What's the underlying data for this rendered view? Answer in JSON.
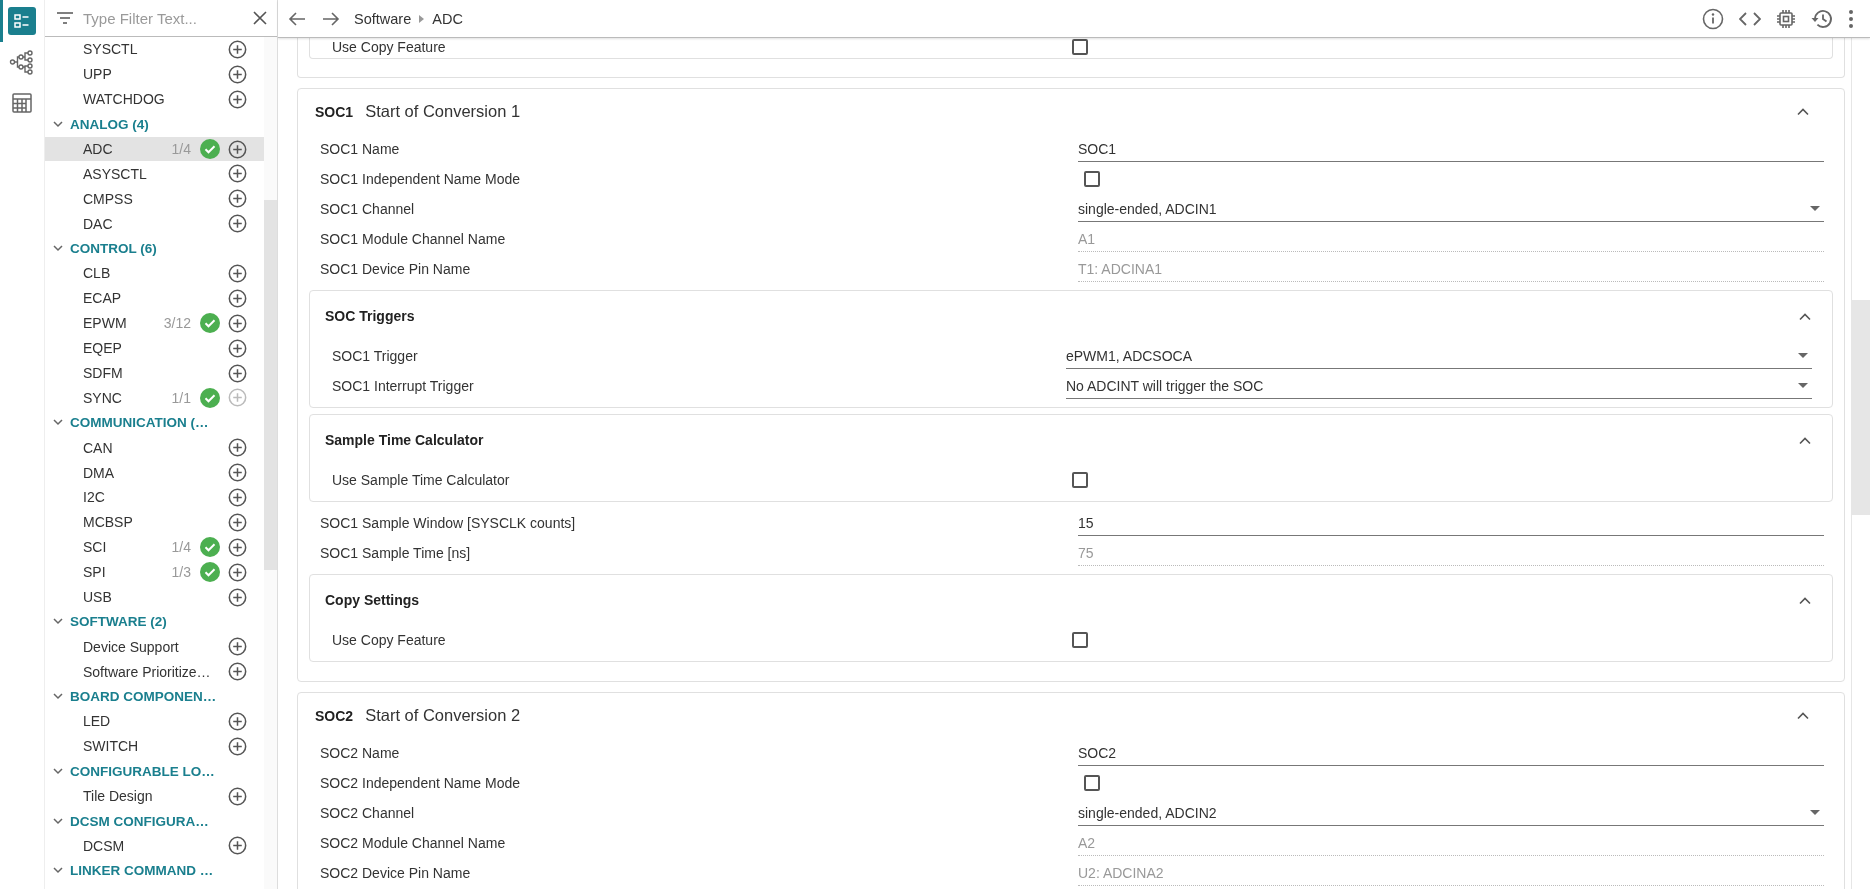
{
  "rail": [
    {
      "kind": "list",
      "selected": true
    },
    {
      "kind": "tree",
      "selected": false
    },
    {
      "kind": "calculator",
      "selected": false
    }
  ],
  "sidebar": {
    "filter": {
      "placeholder": "Type Filter Text..."
    },
    "items": [
      {
        "label": "SYSCTL",
        "configured": false,
        "add_disabled": false,
        "selected": false
      },
      {
        "label": "UPP",
        "configured": false,
        "add_disabled": false,
        "selected": false
      },
      {
        "label": "WATCHDOG",
        "configured": false,
        "add_disabled": false,
        "selected": false
      }
    ],
    "groups": [
      {
        "label": "ANALOG (4)",
        "expanded": true,
        "children": [
          {
            "label": "ADC",
            "count": "1/4",
            "configured": true,
            "add_disabled": false,
            "selected": true
          },
          {
            "label": "ASYSCTL",
            "configured": false,
            "add_disabled": false,
            "selected": false
          },
          {
            "label": "CMPSS",
            "configured": false,
            "add_disabled": false,
            "selected": false
          },
          {
            "label": "DAC",
            "configured": false,
            "add_disabled": false,
            "selected": false
          }
        ]
      },
      {
        "label": "CONTROL (6)",
        "expanded": true,
        "children": [
          {
            "label": "CLB",
            "configured": false,
            "add_disabled": false,
            "selected": false
          },
          {
            "label": "ECAP",
            "configured": false,
            "add_disabled": false,
            "selected": false
          },
          {
            "label": "EPWM",
            "count": "3/12",
            "configured": true,
            "add_disabled": false,
            "selected": false
          },
          {
            "label": "EQEP",
            "configured": false,
            "add_disabled": false,
            "selected": false
          },
          {
            "label": "SDFM",
            "configured": false,
            "add_disabled": false,
            "selected": false
          },
          {
            "label": "SYNC",
            "count": "1/1",
            "configured": true,
            "add_disabled": true,
            "selected": false
          }
        ]
      },
      {
        "label": "COMMUNICATION (…",
        "expanded": true,
        "children": [
          {
            "label": "CAN",
            "configured": false,
            "add_disabled": false,
            "selected": false
          },
          {
            "label": "DMA",
            "configured": false,
            "add_disabled": false,
            "selected": false
          },
          {
            "label": "I2C",
            "configured": false,
            "add_disabled": false,
            "selected": false
          },
          {
            "label": "MCBSP",
            "configured": false,
            "add_disabled": false,
            "selected": false
          },
          {
            "label": "SCI",
            "count": "1/4",
            "configured": true,
            "add_disabled": false,
            "selected": false
          },
          {
            "label": "SPI",
            "count": "1/3",
            "configured": true,
            "add_disabled": false,
            "selected": false
          },
          {
            "label": "USB",
            "configured": false,
            "add_disabled": false,
            "selected": false
          }
        ]
      },
      {
        "label": "SOFTWARE (2)",
        "expanded": true,
        "children": [
          {
            "label": "Device Support",
            "configured": false,
            "add_disabled": false,
            "selected": false
          },
          {
            "label": "Software Prioritize…",
            "configured": false,
            "add_disabled": false,
            "selected": false
          }
        ]
      },
      {
        "label": "BOARD COMPONEN…",
        "expanded": true,
        "children": [
          {
            "label": "LED",
            "configured": false,
            "add_disabled": false,
            "selected": false
          },
          {
            "label": "SWITCH",
            "configured": false,
            "add_disabled": false,
            "selected": false
          }
        ]
      },
      {
        "label": "CONFIGURABLE LO…",
        "expanded": true,
        "children": [
          {
            "label": "Tile Design",
            "configured": false,
            "add_disabled": false,
            "selected": false
          }
        ]
      },
      {
        "label": "DCSM CONFIGURA…",
        "expanded": true,
        "children": [
          {
            "label": "DCSM",
            "configured": false,
            "add_disabled": false,
            "selected": false
          }
        ]
      },
      {
        "label": "LINKER COMMAND …",
        "expanded": true
      }
    ]
  },
  "toolbar": {
    "breadcrumb": [
      "Software",
      "ADC"
    ]
  },
  "content": [
    {
      "kind": "partial",
      "items": [
        {
          "kind": "group",
          "rows": [
            {
              "kind": "checkbox",
              "label": "Use Copy Feature",
              "checked": false
            }
          ]
        }
      ]
    },
    {
      "kind": "card",
      "tag": "SOC1",
      "title": "Start of Conversion 1",
      "expanded": true,
      "items": [
        {
          "kind": "text",
          "label": "SOC1 Name",
          "value": "SOC1"
        },
        {
          "kind": "checkbox",
          "label": "SOC1 Independent Name Mode",
          "checked": false
        },
        {
          "kind": "select",
          "label": "SOC1 Channel",
          "value": "single-ended, ADCIN1"
        },
        {
          "kind": "readonly",
          "label": "SOC1 Module Channel Name",
          "value": "A1"
        },
        {
          "kind": "readonly",
          "label": "SOC1 Device Pin Name",
          "value": "T1: ADCINA1"
        },
        {
          "kind": "group",
          "title": "SOC Triggers",
          "expanded": true,
          "rows": [
            {
              "kind": "select",
              "label": "SOC1 Trigger",
              "value": "ePWM1, ADCSOCA"
            },
            {
              "kind": "select",
              "label": "SOC1 Interrupt Trigger",
              "value": "No ADCINT will trigger the SOC"
            }
          ]
        },
        {
          "kind": "group",
          "title": "Sample Time Calculator",
          "expanded": true,
          "rows": [
            {
              "kind": "checkbox",
              "label": "Use Sample Time Calculator",
              "checked": false
            }
          ]
        },
        {
          "kind": "text",
          "label": "SOC1 Sample Window [SYSCLK counts]",
          "value": "15"
        },
        {
          "kind": "readonly",
          "label": "SOC1 Sample Time [ns]",
          "value": "75"
        },
        {
          "kind": "group",
          "title": "Copy Settings",
          "expanded": true,
          "rows": [
            {
              "kind": "checkbox",
              "label": "Use Copy Feature",
              "checked": false
            }
          ]
        }
      ]
    },
    {
      "kind": "card",
      "tag": "SOC2",
      "title": "Start of Conversion 2",
      "expanded": true,
      "items": [
        {
          "kind": "text",
          "label": "SOC2 Name",
          "value": "SOC2"
        },
        {
          "kind": "checkbox",
          "label": "SOC2 Independent Name Mode",
          "checked": false
        },
        {
          "kind": "select",
          "label": "SOC2 Channel",
          "value": "single-ended, ADCIN2"
        },
        {
          "kind": "readonly",
          "label": "SOC2 Module Channel Name",
          "value": "A2"
        },
        {
          "kind": "readonly",
          "label": "SOC2 Device Pin Name",
          "value": "U2: ADCINA2"
        }
      ]
    }
  ]
}
